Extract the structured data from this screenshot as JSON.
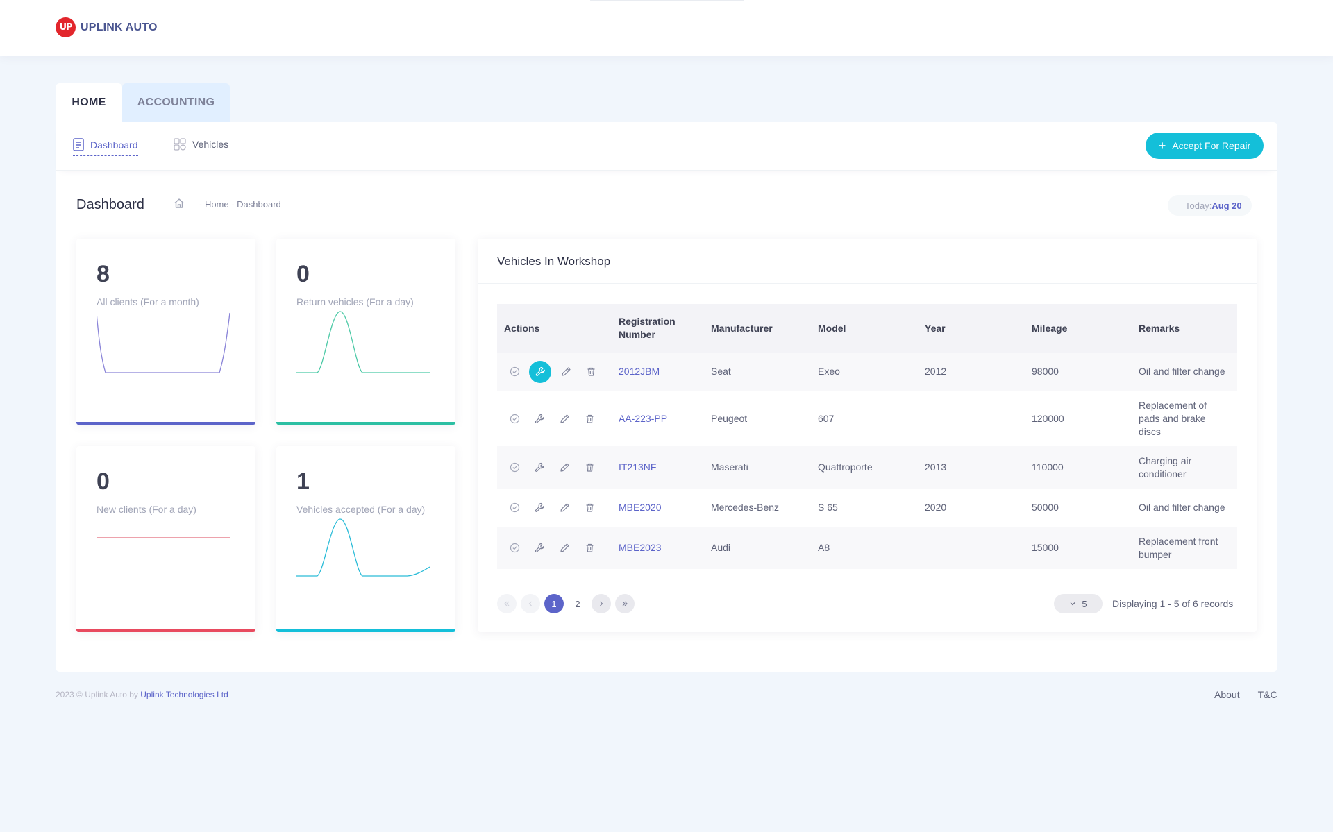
{
  "brand": {
    "logo_mark": "UP",
    "name": "UPLINK AUTO"
  },
  "tabs": [
    {
      "label": "HOME",
      "active": true
    },
    {
      "label": "ACCOUNTING",
      "active": false
    }
  ],
  "subnav": {
    "items": [
      {
        "label": "Dashboard",
        "icon": "document-icon",
        "active": true
      },
      {
        "label": "Vehicles",
        "icon": "vehicles-icon",
        "active": false
      }
    ],
    "accept_button": "Accept For Repair"
  },
  "page": {
    "title": "Dashboard",
    "breadcrumb": "- Home - Dashboard",
    "today_label": "Today:",
    "today_value": "Aug 20"
  },
  "stats": [
    {
      "value": "8",
      "label": "All clients (For a month)",
      "color": "#5c64c9"
    },
    {
      "value": "0",
      "label": "Return vehicles (For a day)",
      "color": "#2cbfa3"
    },
    {
      "value": "0",
      "label": "New clients (For a day)",
      "color": "#e84a5f"
    },
    {
      "value": "1",
      "label": "Vehicles accepted (For a day)",
      "color": "#14bfd9"
    }
  ],
  "workshop": {
    "title": "Vehicles In Workshop",
    "columns": [
      "Actions",
      "Registration Number",
      "Manufacturer",
      "Model",
      "Year",
      "Mileage",
      "Remarks"
    ],
    "rows": [
      {
        "reg": "2012JBM",
        "manufacturer": "Seat",
        "model": "Exeo",
        "year": "2012",
        "mileage": "98000",
        "remarks": "Oil and filter change"
      },
      {
        "reg": "AA-223-PP",
        "manufacturer": "Peugeot",
        "model": "607",
        "year": "",
        "mileage": "120000",
        "remarks": "Replacement of pads and brake discs"
      },
      {
        "reg": "IT213NF",
        "manufacturer": "Maserati",
        "model": "Quattroporte",
        "year": "2013",
        "mileage": "110000",
        "remarks": "Charging air conditioner"
      },
      {
        "reg": "MBE2020",
        "manufacturer": "Mercedes-Benz",
        "model": "S 65",
        "year": "2020",
        "mileage": "50000",
        "remarks": "Oil and filter change"
      },
      {
        "reg": "MBE2023",
        "manufacturer": "Audi",
        "model": "A8",
        "year": "",
        "mileage": "15000",
        "remarks": "Replacement front bumper"
      }
    ],
    "pagination": {
      "pages": [
        "1",
        "2"
      ],
      "current": "1",
      "page_size": "5",
      "records_text": "Displaying 1 - 5 of 6 records"
    }
  },
  "footer": {
    "copyright": "2023 © Uplink Auto by",
    "company": "Uplink Technologies Ltd",
    "links": [
      "About",
      "T&C"
    ]
  }
}
